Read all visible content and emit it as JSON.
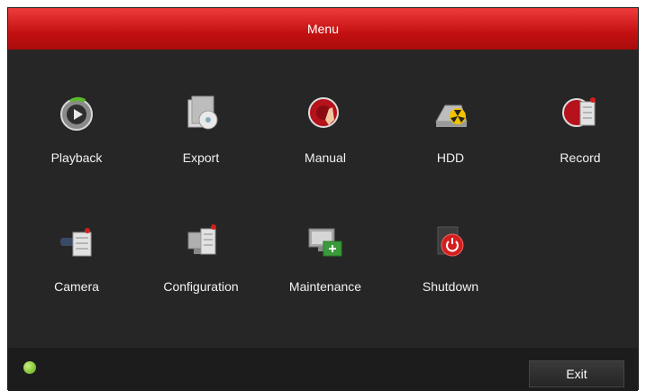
{
  "window": {
    "title": "Menu"
  },
  "menu": {
    "items": [
      {
        "label": "Playback",
        "icon": "playback-icon"
      },
      {
        "label": "Export",
        "icon": "export-icon"
      },
      {
        "label": "Manual",
        "icon": "manual-icon"
      },
      {
        "label": "HDD",
        "icon": "hdd-icon"
      },
      {
        "label": "Record",
        "icon": "record-icon"
      },
      {
        "label": "Camera",
        "icon": "camera-icon"
      },
      {
        "label": "Configuration",
        "icon": "configuration-icon"
      },
      {
        "label": "Maintenance",
        "icon": "maintenance-icon"
      },
      {
        "label": "Shutdown",
        "icon": "shutdown-icon"
      }
    ]
  },
  "footer": {
    "help_icon": "help-icon",
    "exit_label": "Exit"
  },
  "colors": {
    "accent": "#d41e1e",
    "background": "#262626",
    "footer": "#1c1c1c",
    "help": "#7cc43a"
  }
}
